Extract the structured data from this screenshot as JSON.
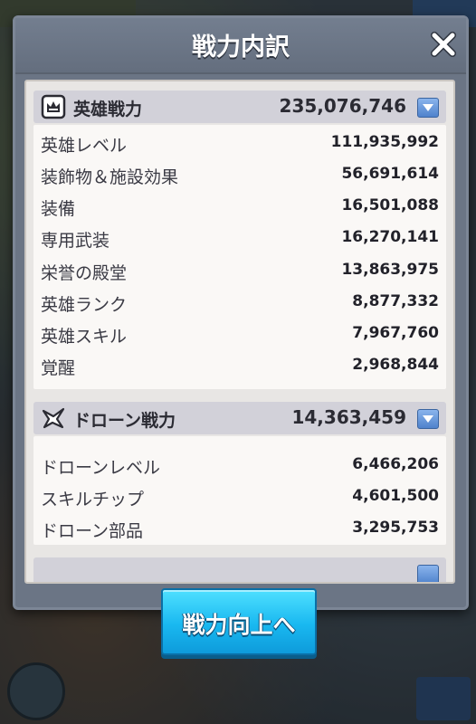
{
  "modal": {
    "title": "戦力内訳",
    "close_icon": "close-icon"
  },
  "hero_section": {
    "icon": "hero-portrait-icon",
    "title": "英雄戦力",
    "total": "235,076,746",
    "rows": [
      {
        "label": "英雄レベル",
        "value": "111,935,992"
      },
      {
        "label": "装飾物＆施設効果",
        "value": "56,691,614"
      },
      {
        "label": "装備",
        "value": "16,501,088"
      },
      {
        "label": "専用武装",
        "value": "16,270,141"
      },
      {
        "label": "栄誉の殿堂",
        "value": "13,863,975"
      },
      {
        "label": "英雄ランク",
        "value": "8,877,332"
      },
      {
        "label": "英雄スキル",
        "value": "7,967,760"
      },
      {
        "label": "覚醒",
        "value": "2,968,844"
      }
    ]
  },
  "drone_section": {
    "icon": "drone-icon",
    "title": "ドローン戦力",
    "total": "14,363,459",
    "rows": [
      {
        "label": "ドローンレベル",
        "value": "6,466,206"
      },
      {
        "label": "スキルチップ",
        "value": "4,601,500"
      },
      {
        "label": "ドローン部品",
        "value": "3,295,753"
      }
    ]
  },
  "action_button": {
    "label": "戦力向上へ"
  },
  "colors": {
    "accent": "#19b8f0",
    "expand_button": "#4f82cc",
    "section_header": "#d2d1d9"
  }
}
